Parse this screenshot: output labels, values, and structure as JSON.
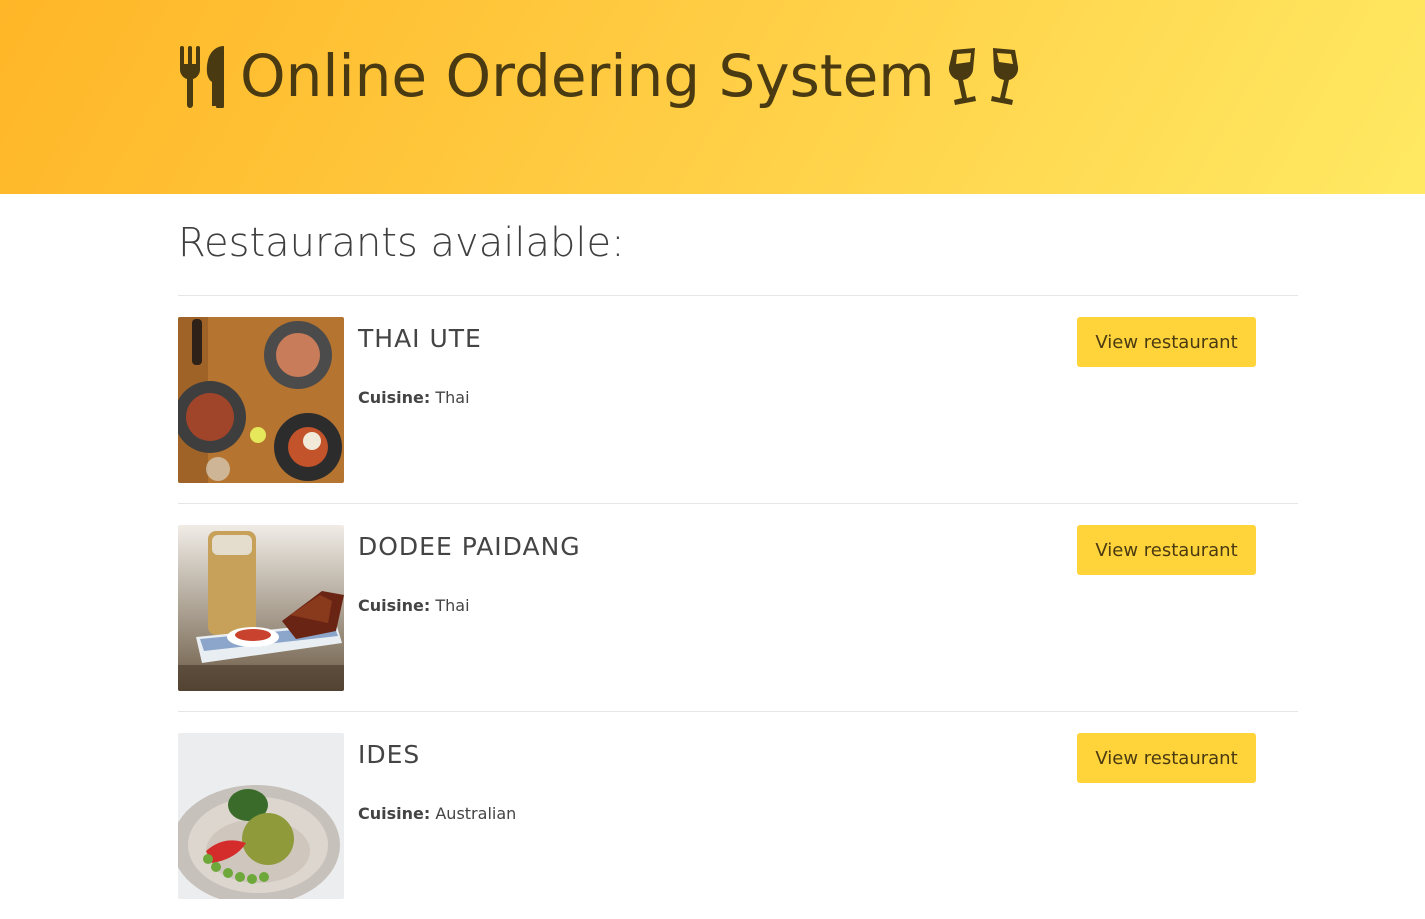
{
  "header": {
    "title": "Online Ordering System",
    "left_icon": "fork-knife-icon",
    "right_icon": "toasting-glasses-icon"
  },
  "main": {
    "heading": "Restaurants available:",
    "cuisine_label": "Cuisine:",
    "restaurants": [
      {
        "name": "THAI UTE",
        "cuisine": "Thai",
        "button": "View restaurant",
        "image": "dish-plates-photo"
      },
      {
        "name": "DODEE PAIDANG",
        "cuisine": "Thai",
        "button": "View restaurant",
        "image": "grilled-meat-photo"
      },
      {
        "name": "IDES",
        "cuisine": "Australian",
        "button": "View restaurant",
        "image": "bowl-dish-photo"
      }
    ]
  },
  "colors": {
    "header_gradient_start": "#ffb627",
    "header_gradient_end": "#ffe963",
    "button": "#ffd43b",
    "title_text": "#4a3a12"
  }
}
